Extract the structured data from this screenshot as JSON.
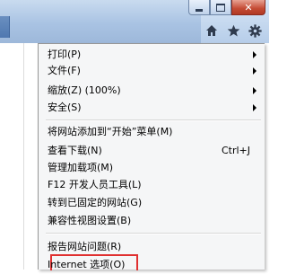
{
  "window": {
    "caption_buttons": [
      "minimize-icon",
      "maximize-icon",
      "close-icon"
    ],
    "toolbar_icons": [
      "home-icon",
      "favorites-star-icon",
      "tools-gear-icon"
    ]
  },
  "menu": {
    "items": [
      {
        "label": "打印(P)",
        "submenu": true
      },
      {
        "label": "文件(F)",
        "submenu": true
      },
      {
        "label": "缩放(Z) (100%)",
        "submenu": true
      },
      {
        "label": "安全(S)",
        "submenu": true
      },
      {
        "label": "将网站添加到“开始”菜单(M)",
        "submenu": false
      },
      {
        "label": "查看下载(N)",
        "shortcut": "Ctrl+J",
        "submenu": false
      },
      {
        "label": "管理加载项(M)",
        "submenu": false
      },
      {
        "label": "F12 开发人员工具(L)",
        "submenu": false
      },
      {
        "label": "转到已固定的网站(G)",
        "submenu": false
      },
      {
        "label": "兼容性视图设置(B)",
        "submenu": false
      },
      {
        "label": "报告网站问题(R)",
        "submenu": false
      },
      {
        "label": "Internet 选项(O)",
        "submenu": false,
        "highlighted": true
      }
    ]
  },
  "colors": {
    "highlight_border": "#e03030",
    "close_button": "#c44a33",
    "chrome": "#a9c3e3"
  }
}
